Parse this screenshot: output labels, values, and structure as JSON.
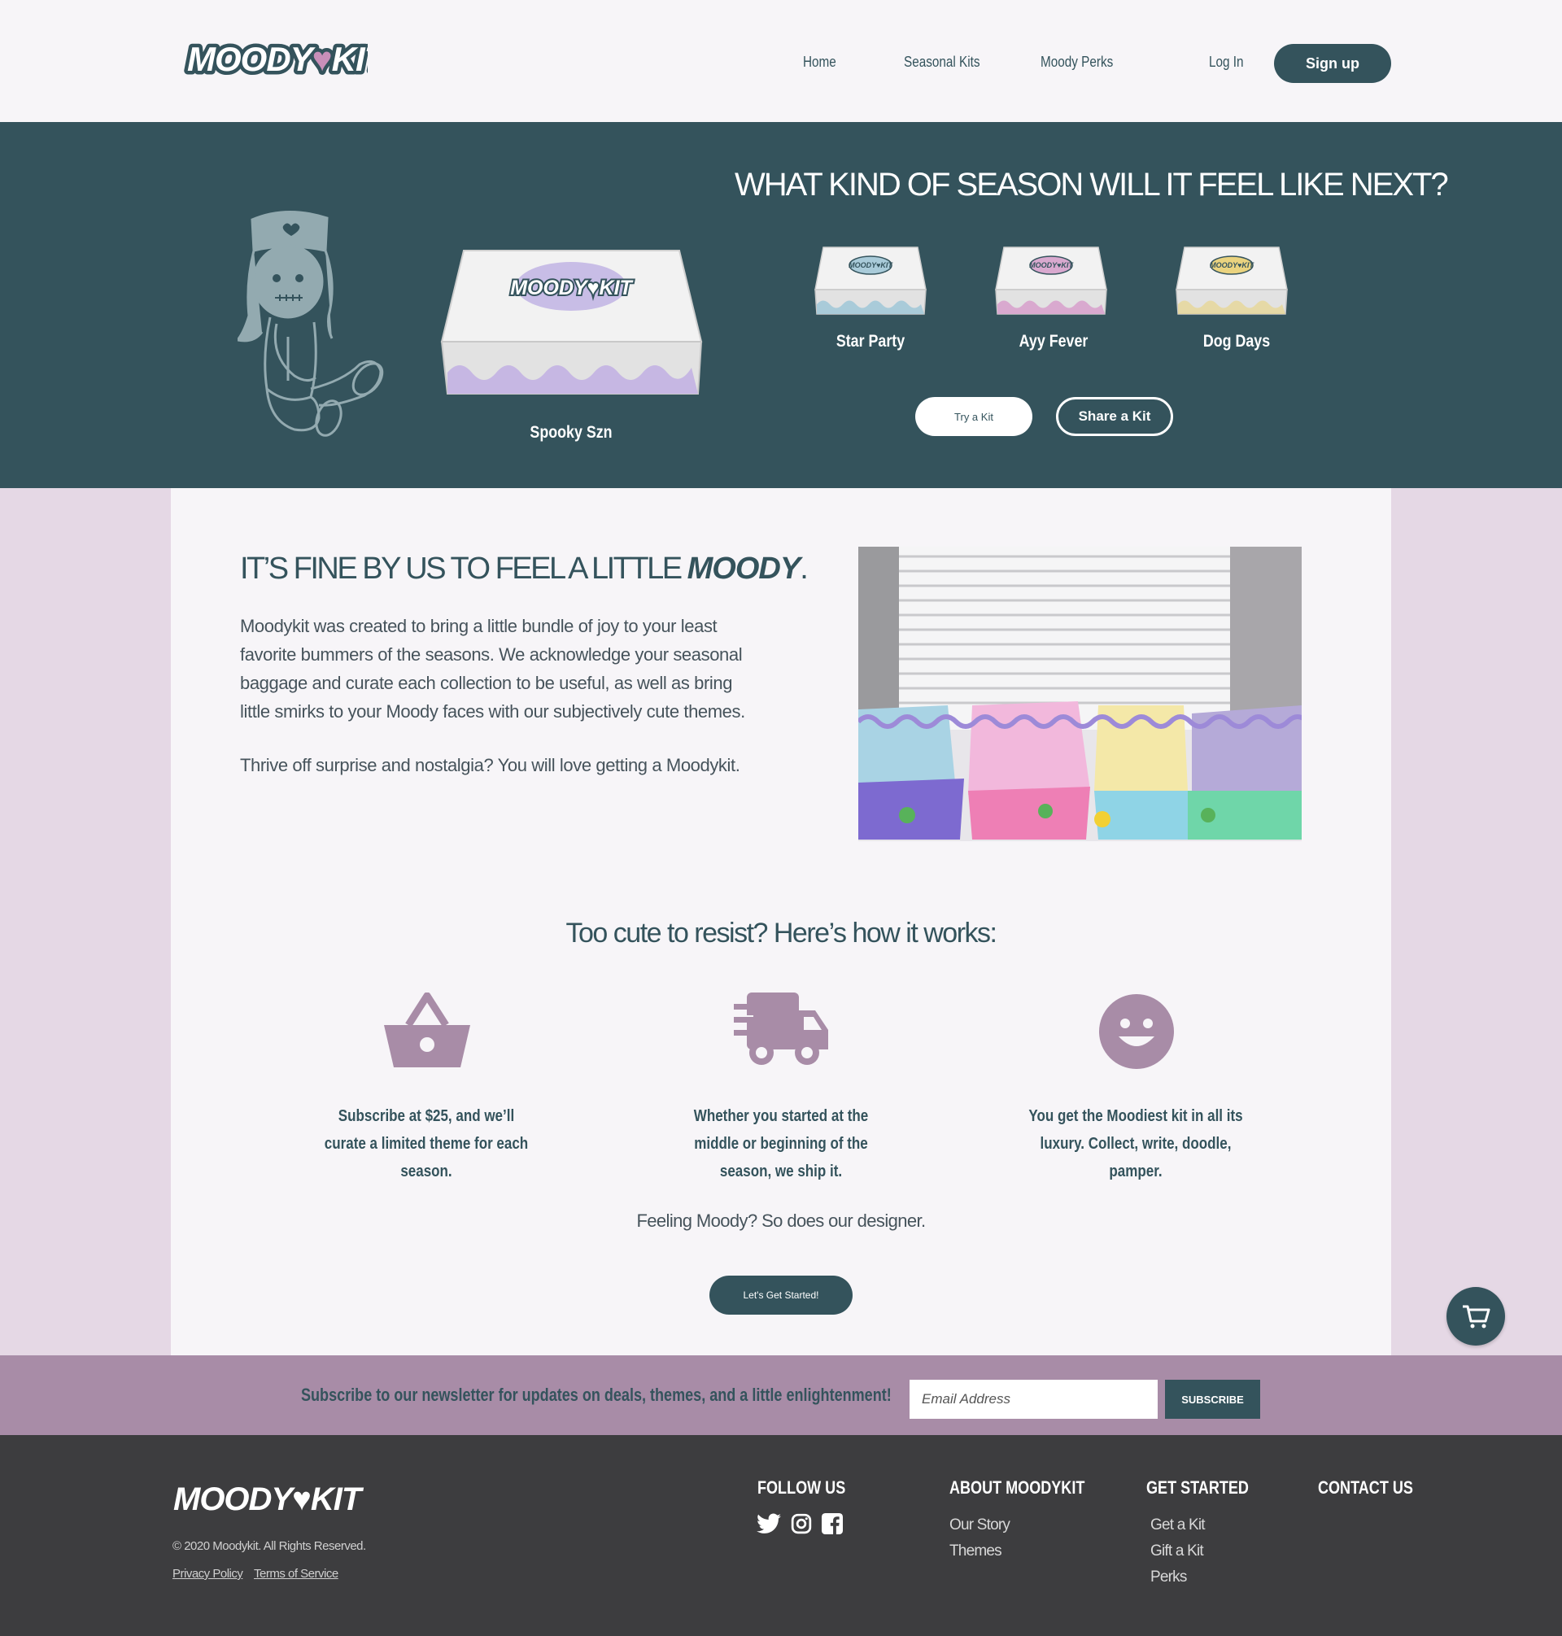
{
  "colors": {
    "teal": "#34535c",
    "lavender": "#a88ca7",
    "panel": "#f7f5f8",
    "page_bg": "#e5d8e5",
    "footer": "#3d3d3f"
  },
  "header": {
    "logo_text": "MOODY♥KIT",
    "nav": [
      "Home",
      "Seasonal Kits",
      "Moody Perks"
    ],
    "login": "Log In",
    "signup": "Sign up"
  },
  "hero": {
    "title": "WHAT KIND OF SEASON WILL IT FEEL LIKE NEXT?",
    "featured_kit": "Spooky Szn",
    "kits": [
      {
        "name": "Star Party",
        "color": "#a9cbd9"
      },
      {
        "name": "Ayy Fever",
        "color": "#d9a9cf"
      },
      {
        "name": "Dog Days",
        "color": "#ead37f"
      }
    ],
    "try_button": "Try a Kit",
    "share_button": "Share a Kit"
  },
  "about": {
    "title_prefix": "IT’S FINE BY US TO FEEL A LITTLE",
    "title_emphasis": "MOODY",
    "title_suffix": ".",
    "paragraph1": "Moodykit was created to bring a little bundle of joy to your least favorite bummers of the seasons.  We acknowledge your seasonal baggage and curate each collection to be useful, as well as bring little smirks to your Moody faces with our subjectively cute themes.",
    "paragraph2": "Thrive off surprise and nostalgia? You will love getting a Moodykit."
  },
  "how": {
    "title": "Too cute to resist? Here’s how it works:",
    "steps": [
      {
        "icon": "basket-icon",
        "text": "Subscribe at $25, and we’ll curate a limited theme for each season."
      },
      {
        "icon": "truck-icon",
        "text": "Whether you started at the middle or beginning of the season, we ship it."
      },
      {
        "icon": "smiley-icon",
        "text": "You get the Moodiest kit in all its luxury. Collect, write, doodle, pamper."
      }
    ],
    "designer_text": "Feeling Moody? So does our designer.",
    "start_button": "Let's Get Started!"
  },
  "cart": {
    "icon": "cart-icon"
  },
  "newsletter": {
    "text": "Subscribe to our newsletter for updates on deals, themes, and a little enlightenment!",
    "placeholder": "Email Address",
    "button": "SUBSCRIBE"
  },
  "footer": {
    "logo_text": "MOODY♥KIT",
    "copyright": "© 2020 Moodykit. All Rights Reserved.",
    "privacy": "Privacy Policy",
    "terms": "Terms of Service",
    "follow_title": "FOLLOW US",
    "social": [
      "twitter-icon",
      "instagram-icon",
      "facebook-icon"
    ],
    "about_title": "ABOUT MOODYKIT",
    "about_links": [
      "Our Story",
      "Themes"
    ],
    "started_title": "GET STARTED",
    "started_links": [
      "Get a Kit",
      "Gift a Kit",
      "Perks"
    ],
    "contact_title": "CONTACT US"
  }
}
